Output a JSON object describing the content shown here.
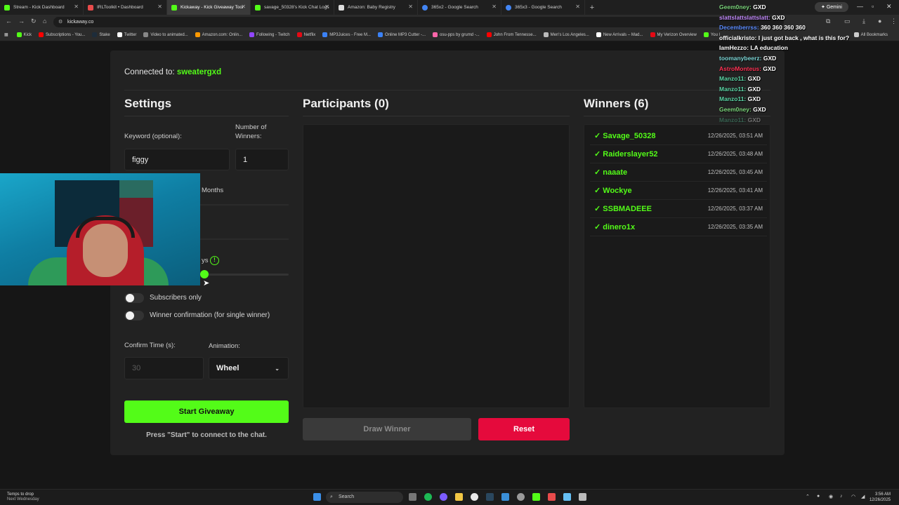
{
  "browser": {
    "tabs": [
      {
        "label": "Stream - Kick Dashboard",
        "color": "#53fc18",
        "active": false
      },
      {
        "label": "IRLToolkit • Dashboard",
        "color": "#e84b4b",
        "active": false
      },
      {
        "label": "Kickaway - Kick Giveaway Tool",
        "color": "#53fc18",
        "active": true
      },
      {
        "label": "savage_50328's Kick Chat Logs",
        "color": "#53fc18",
        "active": false
      },
      {
        "label": "Amazon: Baby Registry",
        "color": "#dddddd",
        "active": false
      },
      {
        "label": "365x2 - Google Search",
        "color": "#4285f4",
        "active": false
      },
      {
        "label": "365x3 - Google Search",
        "color": "#4285f4",
        "active": false
      }
    ],
    "gemini_label": "Gemini",
    "url": "kickaway.co",
    "bookmarks": [
      {
        "label": "Kick",
        "color": "#53fc18"
      },
      {
        "label": "Subscriptions - You...",
        "color": "#ff0000"
      },
      {
        "label": "Stake",
        "color": "#1d2c3a"
      },
      {
        "label": "Twitter",
        "color": "#ffffff"
      },
      {
        "label": "Video to animated...",
        "color": "#888888"
      },
      {
        "label": "Amazon.com: Onlin...",
        "color": "#ff9900"
      },
      {
        "label": "Following - Twitch",
        "color": "#9146ff"
      },
      {
        "label": "Netflix",
        "color": "#e50914"
      },
      {
        "label": "MP3Juices - Free M...",
        "color": "#3b82f6"
      },
      {
        "label": "Online MP3 Cutter -...",
        "color": "#3b82f6"
      },
      {
        "label": "osu-pps by grumd -...",
        "color": "#ff66aa"
      },
      {
        "label": "John From Tennesse...",
        "color": "#ff0000"
      },
      {
        "label": "Men's Los Angeles...",
        "color": "#bbbbbb"
      },
      {
        "label": "New Arrivals – Mad...",
        "color": "#ffffff"
      },
      {
        "label": "My Verizon Overview",
        "color": "#e50914"
      },
      {
        "label": "You l",
        "color": "#53fc18"
      }
    ],
    "all_bookmarks_label": "All Bookmarks"
  },
  "app": {
    "connected_label": "Connected to:",
    "connected_user": "sweatergxd",
    "settings": {
      "title": "Settings",
      "keyword_label": "Keyword (optional):",
      "keyword_value": "figgy",
      "winners_label_line1": "Number of",
      "winners_label_line2": "Winners:",
      "winners_value": "1",
      "months_label": "Months",
      "days_label_partial": "ys",
      "slider_level_fraction": 0.0,
      "subscribers_label": "Subscribers only",
      "confirmation_label": "Winner confirmation (for single winner)",
      "confirm_time_label": "Confirm Time (s):",
      "confirm_time_value": "30",
      "animation_label": "Animation:",
      "animation_value": "Wheel",
      "start_button": "Start Giveaway",
      "hint": "Press \"Start\" to connect to the chat."
    },
    "participants": {
      "title": "Participants (0)",
      "draw_button": "Draw Winner",
      "reset_button": "Reset"
    },
    "winners": {
      "title": "Winners (6)",
      "list": [
        {
          "name": "✓ Savage_50328",
          "time": "12/26/2025, 03:51 AM"
        },
        {
          "name": "✓ Raiderslayer52",
          "time": "12/26/2025, 03:48 AM"
        },
        {
          "name": "✓ naaate",
          "time": "12/26/2025, 03:45 AM"
        },
        {
          "name": "✓ Wockye",
          "time": "12/26/2025, 03:41 AM"
        },
        {
          "name": "✓ SSBMADEEE",
          "time": "12/26/2025, 03:37 AM"
        },
        {
          "name": "✓ dinero1x",
          "time": "12/26/2025, 03:35 AM"
        }
      ]
    },
    "accent_color": "#53fc18",
    "danger_color": "#e50a3c"
  },
  "chat": [
    {
      "user": "Geem0ney:",
      "user_color": "#7cd67c",
      "msg": "GXD"
    },
    {
      "user": "slattslattslattslatt:",
      "user_color": "#c58cff",
      "msg": "GXD"
    },
    {
      "user": "Decemberrss:",
      "user_color": "#5b8cff",
      "msg": "360 360 360 360"
    },
    {
      "user": "officialkristo:",
      "user_color": "#ffffff",
      "msg": "I just got back , what is this for?"
    },
    {
      "user": "IamHezzo:",
      "user_color": "#ffffff",
      "msg": "LA education"
    },
    {
      "user": "toomanybeerz:",
      "user_color": "#7cd6d6",
      "msg": "GXD"
    },
    {
      "user": "AstroMonteus:",
      "user_color": "#ff3355",
      "msg": "GXD"
    },
    {
      "user": "Manzo11:",
      "user_color": "#5bd6a6",
      "msg": "GXD"
    },
    {
      "user": "Manzo11:",
      "user_color": "#5bd6a6",
      "msg": "GXD"
    },
    {
      "user": "Manzo11:",
      "user_color": "#5bd6a6",
      "msg": "GXD"
    },
    {
      "user": "Geem0ney:",
      "user_color": "#7cd67c",
      "msg": "GXD"
    },
    {
      "user": "Manzo11:",
      "user_color": "#5bd6a6",
      "msg": "GXD"
    }
  ],
  "taskbar": {
    "weather_line1": "Temps to drop",
    "weather_line2": "Next Wednesday",
    "search_label": "Search",
    "time": "3:56 AM",
    "date": "12/26/2025"
  }
}
